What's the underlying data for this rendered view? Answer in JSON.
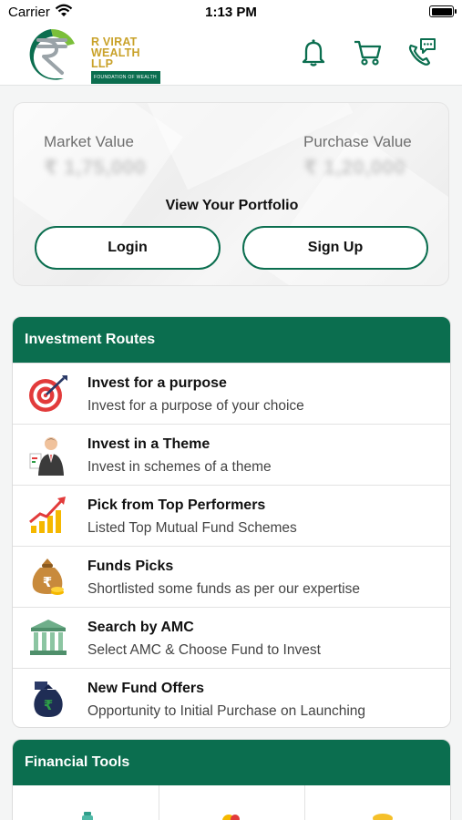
{
  "status_bar": {
    "carrier": "Carrier",
    "time": "1:13 PM"
  },
  "brand": {
    "line1": "R VIRAT",
    "line2": "WEALTH LLP",
    "tagline": "FOUNDATION OF WEALTH"
  },
  "header_icons": [
    "bell-icon",
    "cart-icon",
    "chat-phone-icon"
  ],
  "portfolio": {
    "market_value_label": "Market Value",
    "market_value": "₹ 1,75,000",
    "purchase_value_label": "Purchase Value",
    "purchase_value": "₹ 1,20,000",
    "title": "View Your Portfolio",
    "login_label": "Login",
    "signup_label": "Sign Up"
  },
  "investment_routes": {
    "title": "Investment Routes",
    "items": [
      {
        "title": "Invest for a purpose",
        "subtitle": "Invest for a purpose of your choice",
        "icon": "target-icon"
      },
      {
        "title": "Invest in a Theme",
        "subtitle": "Invest in schemes of a theme",
        "icon": "businessman-icon"
      },
      {
        "title": "Pick from Top Performers",
        "subtitle": "Listed Top Mutual Fund Schemes",
        "icon": "growth-chart-icon"
      },
      {
        "title": "Funds Picks",
        "subtitle": "Shortlisted some funds as per our expertise",
        "icon": "money-bag-icon"
      },
      {
        "title": "Search by AMC",
        "subtitle": "Select AMC & Choose Fund to Invest",
        "icon": "bank-icon"
      },
      {
        "title": "New Fund Offers",
        "subtitle": "Opportunity to Initial Purchase on Launching",
        "icon": "new-fund-bag-icon"
      }
    ]
  },
  "financial_tools": {
    "title": "Financial Tools",
    "icons": [
      "calculator-tool-icon",
      "coins-tool-icon",
      "gold-tool-icon"
    ]
  },
  "colors": {
    "brand_green": "#0b6e4f",
    "brand_gold": "#c9a22a"
  }
}
